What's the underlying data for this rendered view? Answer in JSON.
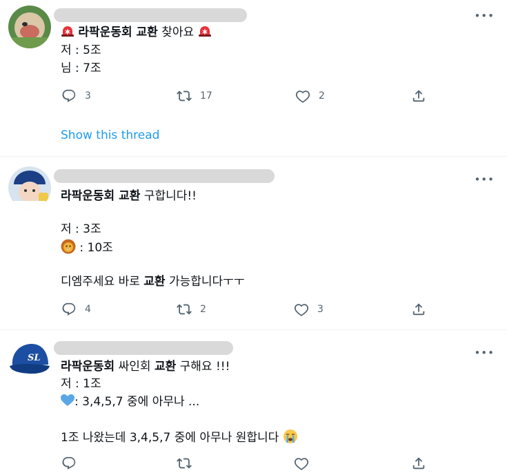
{
  "tweets": [
    {
      "avatar": "user-avatar-1",
      "lines": [
        {
          "pre": "",
          "emoji_before": "siren",
          "bold": "라팍운동회 교환",
          "post": " 찾아요 ",
          "emoji_after": "siren"
        },
        {
          "text": "저 : 5조"
        },
        {
          "text": "님 : 7조"
        }
      ],
      "actions": {
        "reply": "3",
        "retweet": "17",
        "like": "2",
        "share": ""
      },
      "thread_link": "Show this thread"
    },
    {
      "avatar": "user-avatar-2",
      "lines": [
        {
          "bold": "라팍운동회 교환",
          "post": " 구합니다!!"
        },
        {
          "text": "저 : 3조"
        },
        {
          "emoji": "lion",
          "text": " : 10조"
        },
        {
          "pre": "디엠주세요 바로 ",
          "bold": "교환",
          "post": " 가능합니다ㅜㅜ"
        }
      ],
      "actions": {
        "reply": "4",
        "retweet": "2",
        "like": "3",
        "share": ""
      }
    },
    {
      "avatar": "samsung-lions-cap-avatar",
      "lines": [
        {
          "bold1": "라팍운동회",
          "mid": " 싸인회 ",
          "bold2": "교환",
          "post": " 구해요 !!!"
        },
        {
          "text": "저 : 1조"
        },
        {
          "emoji": "blue-heart",
          "text": ": 3,4,5,7 중에 아무나 ..."
        },
        {
          "text": "1조 나왔는데 3,4,5,7 중에 아무나 원합니다 ",
          "emoji_after": "crying-face"
        }
      ],
      "actions": {
        "reply": "",
        "retweet": "",
        "like": "",
        "share": ""
      }
    }
  ],
  "icons": {
    "more": "more-icon",
    "reply": "reply-icon",
    "retweet": "retweet-icon",
    "like": "heart-icon",
    "share": "share-icon"
  },
  "colors": {
    "link": "#1d9bf0",
    "icon": "#536471",
    "text": "#0f1419",
    "divider": "#eff3f4"
  }
}
